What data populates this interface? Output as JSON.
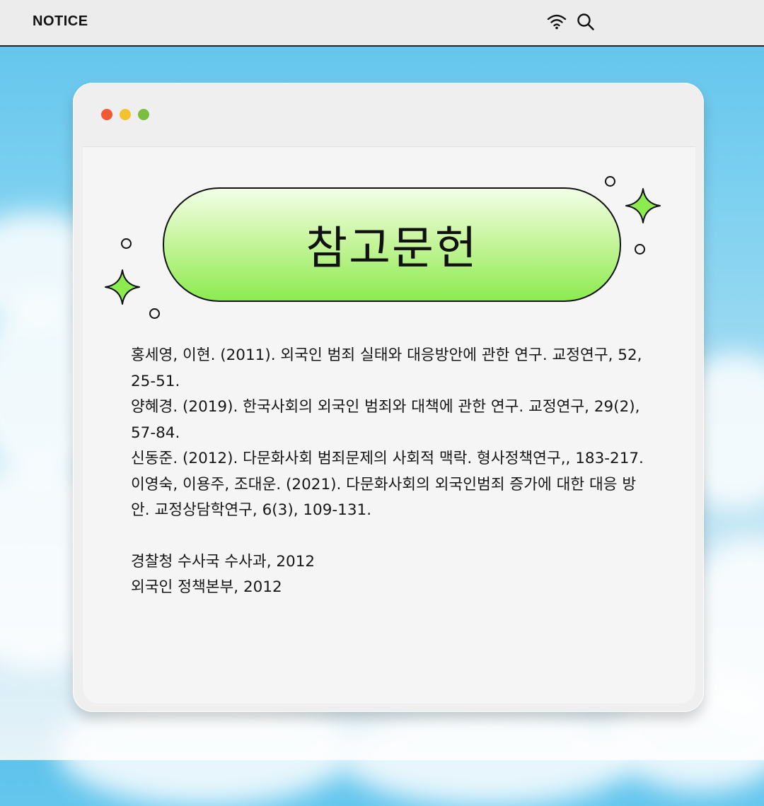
{
  "topbar": {
    "title": "NOTICE",
    "icons": [
      "wifi-icon",
      "search-icon"
    ]
  },
  "window": {
    "controls": [
      "close",
      "minimize",
      "maximize"
    ],
    "heading": "참고문헌",
    "references": [
      "홍세영, 이현. (2011). 외국인 범죄 실태와 대응방안에 관한 연구. 교정연구, 52, 25-51.",
      "양혜경. (2019). 한국사회의 외국인 범죄와 대책에 관한 연구. 교정연구, 29(2), 57-84.",
      "신동준. (2012). 다문화사회 범죄문제의 사회적 맥락. 형사정책연구,, 183-217.",
      "이영숙, 이용주, 조대운. (2021). 다문화사회의 외국인범죄 증가에 대한 대응 방안. 교정상담학연구, 6(3), 109-131."
    ],
    "sources": [
      "경찰청 수사국 수사과, 2012",
      "외국인 정책본부, 2012"
    ]
  },
  "colors": {
    "accent_green": "#8ceb4f",
    "dot_red": "#f05a35",
    "dot_yellow": "#f4c12f",
    "dot_green": "#7bbd3f"
  }
}
